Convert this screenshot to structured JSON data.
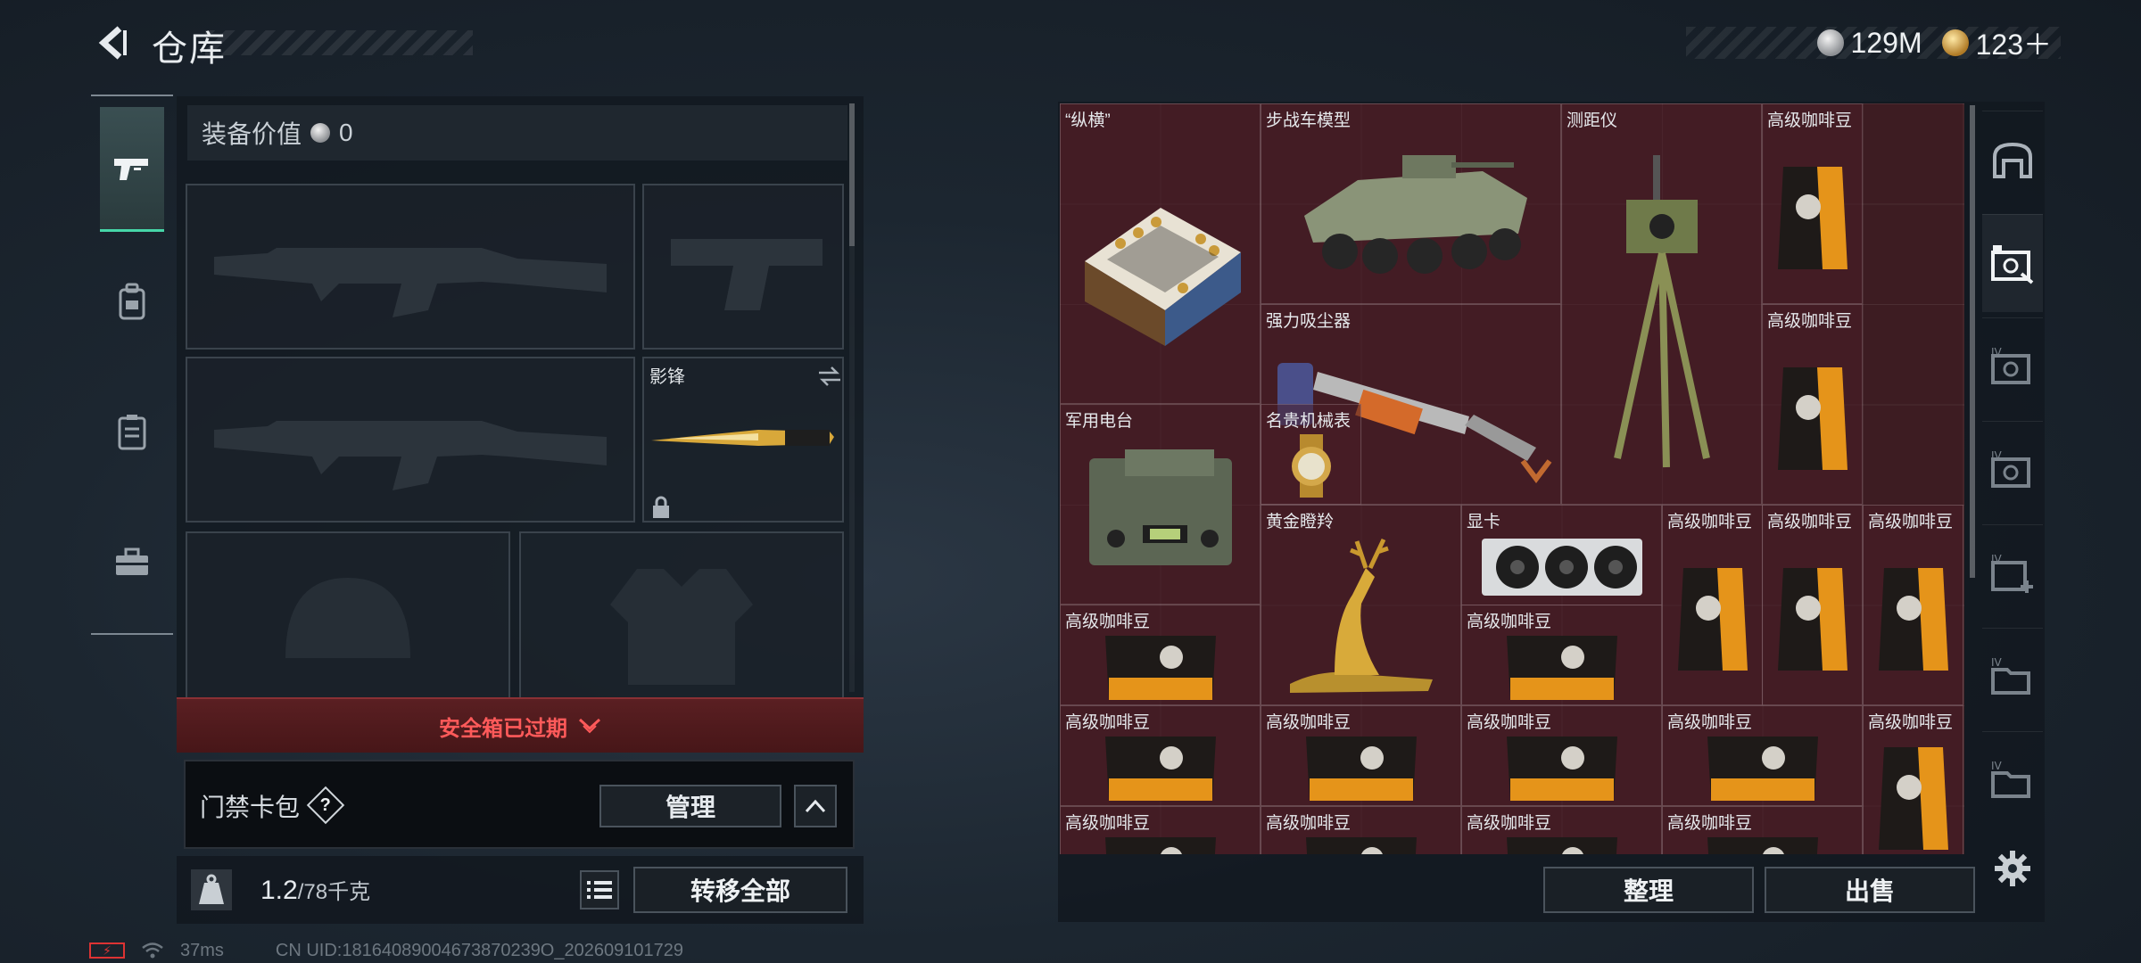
{
  "header": {
    "title": "仓库",
    "currencies": [
      {
        "icon": "silver-coin-icon",
        "value": "129M"
      },
      {
        "icon": "gold-coin-icon",
        "value": "123＋"
      }
    ]
  },
  "left_tabs": [
    {
      "icon": "pistol-icon",
      "active": true
    },
    {
      "icon": "backpack-icon",
      "active": false
    },
    {
      "icon": "vest-icon",
      "active": false
    },
    {
      "icon": "toolbox-icon",
      "active": false
    }
  ],
  "equipment": {
    "value_label": "装备价值",
    "value": "0",
    "slots": [
      {
        "id": "primary-weapon-1",
        "label": "",
        "icon": "rifle-silhouette-icon"
      },
      {
        "id": "secondary-weapon",
        "label": "",
        "icon": "pistol-silhouette-icon"
      },
      {
        "id": "primary-weapon-2",
        "label": "",
        "icon": "rifle-silhouette-icon"
      },
      {
        "id": "melee",
        "label": "影锋",
        "icon": "knife-icon"
      },
      {
        "id": "helmet",
        "label": "",
        "icon": "helmet-silhouette-icon"
      },
      {
        "id": "armor",
        "label": "",
        "icon": "armor-silhouette-icon"
      }
    ]
  },
  "safebox": {
    "text": "安全箱已过期"
  },
  "keycard": {
    "label": "门禁卡包",
    "help": "?",
    "manage_label": "管理"
  },
  "capacity": {
    "current": "1.2",
    "max": "/78千克"
  },
  "transfer_all_label": "转移全部",
  "status_bar": {
    "ping": "37ms",
    "uid": "CN UID:18164089004673870239O_202609101729"
  },
  "inventory": {
    "items": [
      {
        "name": "“纵横”",
        "icon": "chess-board-icon"
      },
      {
        "name": "步战车模型",
        "icon": "ifv-model-icon"
      },
      {
        "name": "测距仪",
        "icon": "rangefinder-icon"
      },
      {
        "name": "高级咖啡豆",
        "icon": "coffee-bag-icon"
      },
      {
        "name": "强力吸尘器",
        "icon": "vacuum-icon"
      },
      {
        "name": "高级咖啡豆",
        "icon": "coffee-bag-icon"
      },
      {
        "name": "军用电台",
        "icon": "radio-icon"
      },
      {
        "name": "名贵机械表",
        "icon": "watch-icon"
      },
      {
        "name": "黄金瞪羚",
        "icon": "gazelle-icon"
      },
      {
        "name": "显卡",
        "icon": "gpu-icon"
      },
      {
        "name": "高级咖啡豆",
        "icon": "coffee-bag-icon"
      },
      {
        "name": "高级咖啡豆",
        "icon": "coffee-bag-icon"
      },
      {
        "name": "高级咖啡豆",
        "icon": "coffee-bag-icon"
      },
      {
        "name": "高级咖啡豆",
        "icon": "coffee-bag-flat-icon"
      },
      {
        "name": "高级咖啡豆",
        "icon": "coffee-bag-flat-icon"
      },
      {
        "name": "高级咖啡豆",
        "icon": "coffee-bag-flat-icon"
      },
      {
        "name": "高级咖啡豆",
        "icon": "coffee-bag-flat-icon"
      },
      {
        "name": "高级咖啡豆",
        "icon": "coffee-bag-flat-icon"
      },
      {
        "name": "高级咖啡豆",
        "icon": "coffee-bag-flat-icon"
      },
      {
        "name": "高级咖啡豆",
        "icon": "coffee-bag-icon"
      },
      {
        "name": "高级咖啡豆",
        "icon": "coffee-bag-flat-icon"
      },
      {
        "name": "高级咖啡豆",
        "icon": "coffee-bag-flat-icon"
      },
      {
        "name": "高级咖啡豆",
        "icon": "coffee-bag-flat-icon"
      },
      {
        "name": "高级咖啡豆",
        "icon": "coffee-bag-flat-icon"
      }
    ]
  },
  "right_tabs": [
    {
      "icon": "all-storage-icon",
      "active": false
    },
    {
      "icon": "storage-box-1-icon",
      "active": true
    },
    {
      "icon": "storage-box-4-icon",
      "active": false
    },
    {
      "icon": "storage-box-4b-icon",
      "active": false
    },
    {
      "icon": "storage-box-add-icon",
      "active": false
    },
    {
      "icon": "storage-folder-icon",
      "active": false
    },
    {
      "icon": "storage-folder-2-icon",
      "active": false
    }
  ],
  "actions": {
    "sort_label": "整理",
    "sell_label": "出售"
  },
  "colors": {
    "accent": "#46d6a8",
    "alert": "#ff5a5a",
    "grid_bg": "#3d1c22"
  }
}
